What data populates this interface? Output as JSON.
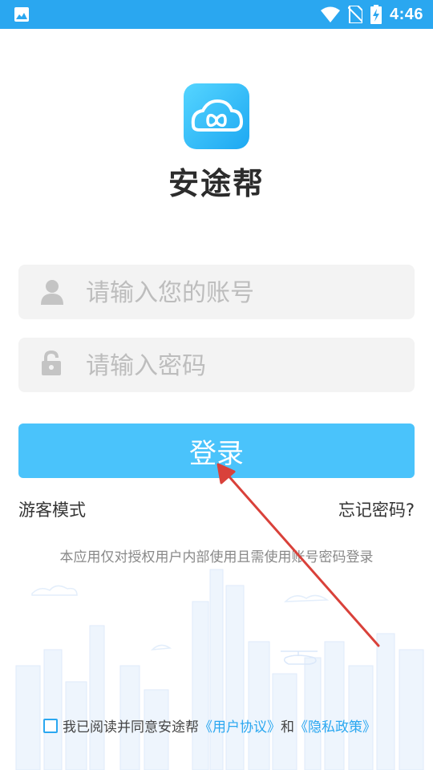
{
  "status_bar": {
    "time": "4:46"
  },
  "app": {
    "name": "安途帮"
  },
  "form": {
    "account_placeholder": "请输入您的账号",
    "password_placeholder": "请输入密码",
    "login_label": "登录"
  },
  "links": {
    "guest_mode": "游客模式",
    "forgot_password": "忘记密码?"
  },
  "notice": "本应用仅对授权用户内部使用且需使用账号密码登录",
  "agreement": {
    "prefix": "我已阅读并同意安途帮",
    "user_agreement": "《用户协议》",
    "and": "和",
    "privacy_policy": "《隐私政策》",
    "checked": false
  },
  "colors": {
    "status_bar": "#2aa7f0",
    "accent": "#4ac3fb",
    "arrow": "#d9413a"
  }
}
